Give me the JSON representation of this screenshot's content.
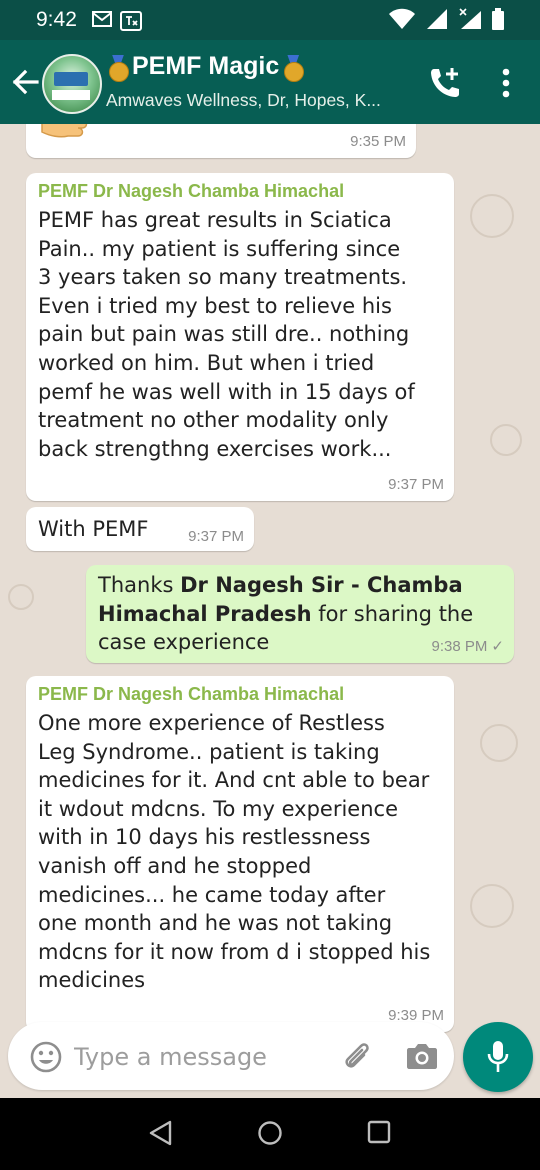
{
  "status_bar": {
    "time": "9:42",
    "icons_left": [
      "gmail-icon",
      "translate-icon"
    ],
    "icons_right": [
      "wifi-icon",
      "signal-icon",
      "signal-x-icon",
      "battery-icon"
    ]
  },
  "header": {
    "title": "PEMF Magic",
    "subtitle": "Amwaves Wellness, Dr, Hopes, K...",
    "title_badges": [
      "medal-icon",
      "medal-icon"
    ],
    "actions": [
      "add-call-icon",
      "more-options-icon"
    ]
  },
  "messages": [
    {
      "direction": "in",
      "sender": "",
      "text": "",
      "emoji": "thumbs-up",
      "time": "9:35 PM"
    },
    {
      "direction": "in",
      "sender": "PEMF Dr Nagesh Chamba Himachal",
      "text": "PEMF has great results in Sciatica\nPain.. my patient is suffering since\n3 years taken so many treatments.\nEven i tried my best to relieve his\npain but pain was still dre.. nothing\nworked on him. But when i tried\npemf he was well with in 15 days of\ntreatment no other modality only\nback strengthng exercises work...",
      "time": "9:37 PM"
    },
    {
      "direction": "in",
      "sender": "",
      "text": "With PEMF",
      "time": "9:37 PM"
    },
    {
      "direction": "out",
      "text_prefix": "Thanks ",
      "text_bold": "Dr Nagesh Sir - Chamba\nHimachal Pradesh",
      "text_suffix": " for sharing the\ncase experience",
      "time": "9:38 PM",
      "status": "✓"
    },
    {
      "direction": "in",
      "sender": "PEMF Dr Nagesh Chamba Himachal",
      "text": "One more experience of Restless\nLeg Syndrome.. patient is taking\nmedicines for it. And cnt able to bear\nit wdout mdcns. To my experience\nwith in 10 days his restlessness\nvanish off and he stopped\nmedicines... he came today after\none month and he was not taking\nmdcns for it now from d i stopped his\nmedicines",
      "time": "9:39 PM"
    }
  ],
  "composer": {
    "placeholder": "Type a message",
    "icons": [
      "emoji-icon",
      "attach-icon",
      "camera-icon",
      "mic-icon"
    ]
  },
  "nav_bar": {
    "icons": [
      "back-triangle-icon",
      "home-circle-icon",
      "recents-square-icon"
    ]
  },
  "colors": {
    "app_bar": "#075e54",
    "status_bar": "#0b4f47",
    "chat_background": "#e6ddd4",
    "incoming_bubble": "#ffffff",
    "outgoing_bubble": "#dcf8c6",
    "sender_name": "#8bb84b",
    "fab": "#00897b"
  }
}
